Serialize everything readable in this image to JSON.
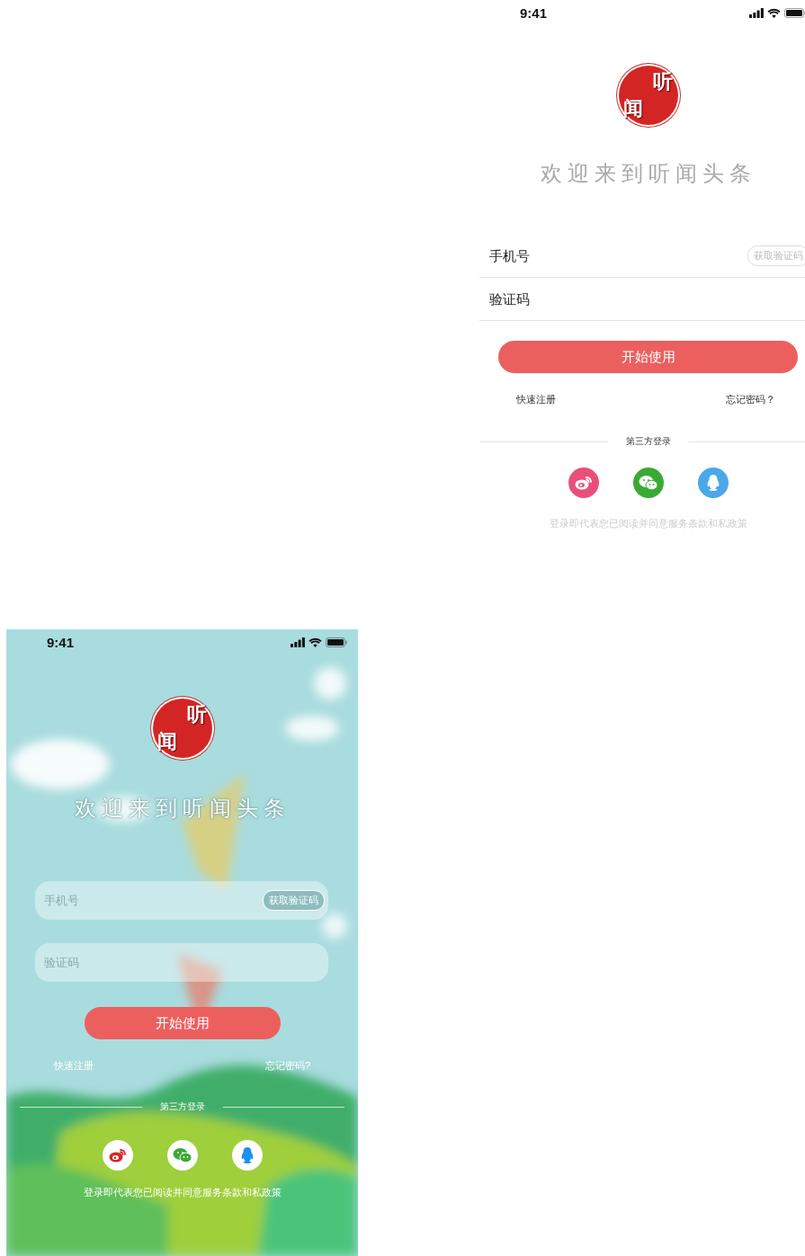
{
  "screens": [
    {
      "kind": "plain",
      "status_bar": {
        "time": "9:41"
      },
      "logo": [
        "听",
        "闻"
      ],
      "title": "欢迎来到听闻头条",
      "phone_field": {
        "placeholder": "手机号",
        "action": "获取验证码"
      },
      "code_field": {
        "placeholder": "验证码"
      },
      "submit": "开始使用",
      "links": [
        "快速注册",
        "忘记密码？"
      ],
      "third_party_label": "第三方登录",
      "social": [
        {
          "kind": "weibo"
        },
        {
          "kind": "wechat"
        },
        {
          "kind": "qq"
        }
      ],
      "agreement": "登录即代表您已阅读并同意服务条款和私政策"
    },
    {
      "kind": "scenic",
      "status_bar": {
        "time": "9:41"
      },
      "logo": [
        "听",
        "闻"
      ],
      "title": "欢迎来到听闻头条",
      "phone_field": {
        "placeholder": "手机号",
        "action": "获取验证码"
      },
      "code_field": {
        "placeholder": "验证码"
      },
      "submit": "开始使用",
      "links": [
        "快速注册",
        "忘记密码?"
      ],
      "third_party_label": "第三方登录",
      "social": [
        {
          "kind": "weibo"
        },
        {
          "kind": "wechat"
        },
        {
          "kind": "qq"
        }
      ],
      "agreement": "登录即代表您已阅读并同意服务条款和私政策"
    }
  ]
}
